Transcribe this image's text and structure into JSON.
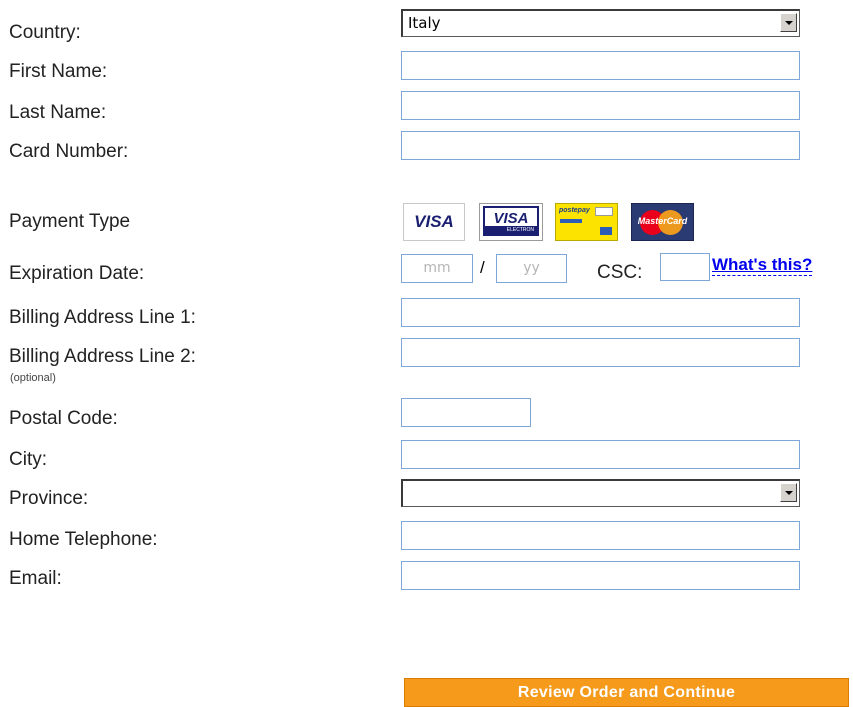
{
  "form": {
    "country": {
      "label": "Country:",
      "value": "Italy"
    },
    "first_name": {
      "label": "First Name:",
      "value": ""
    },
    "last_name": {
      "label": "Last Name:",
      "value": ""
    },
    "card_number": {
      "label": "Card Number:",
      "value": ""
    },
    "payment_type": {
      "label": "Payment Type",
      "cards": [
        "VISA",
        "VISA ELECTRON",
        "postepay",
        "MasterCard"
      ]
    },
    "expiration": {
      "label": "Expiration Date:",
      "month_placeholder": "mm",
      "separator": "/",
      "year_placeholder": "yy"
    },
    "csc": {
      "label": "CSC:",
      "help_link": "What's this?"
    },
    "billing_line1": {
      "label": "Billing Address Line 1:",
      "value": ""
    },
    "billing_line2": {
      "label": "Billing Address Line 2:",
      "optional": "(optional)",
      "value": ""
    },
    "postal_code": {
      "label": "Postal Code:",
      "value": ""
    },
    "city": {
      "label": "City:",
      "value": ""
    },
    "province": {
      "label": "Province:",
      "value": ""
    },
    "home_telephone": {
      "label": "Home Telephone:",
      "value": ""
    },
    "email": {
      "label": "Email:",
      "value": ""
    },
    "submit_label": "Review Order and Continue"
  },
  "colors": {
    "field_border": "#7fa6d8",
    "button_bg": "#f59a1a",
    "link": "#0000ee",
    "visa_blue": "#1a1f71",
    "mastercard_red": "#eb001b",
    "mastercard_yellow": "#f79e1b",
    "postepay_yellow": "#fde400"
  }
}
